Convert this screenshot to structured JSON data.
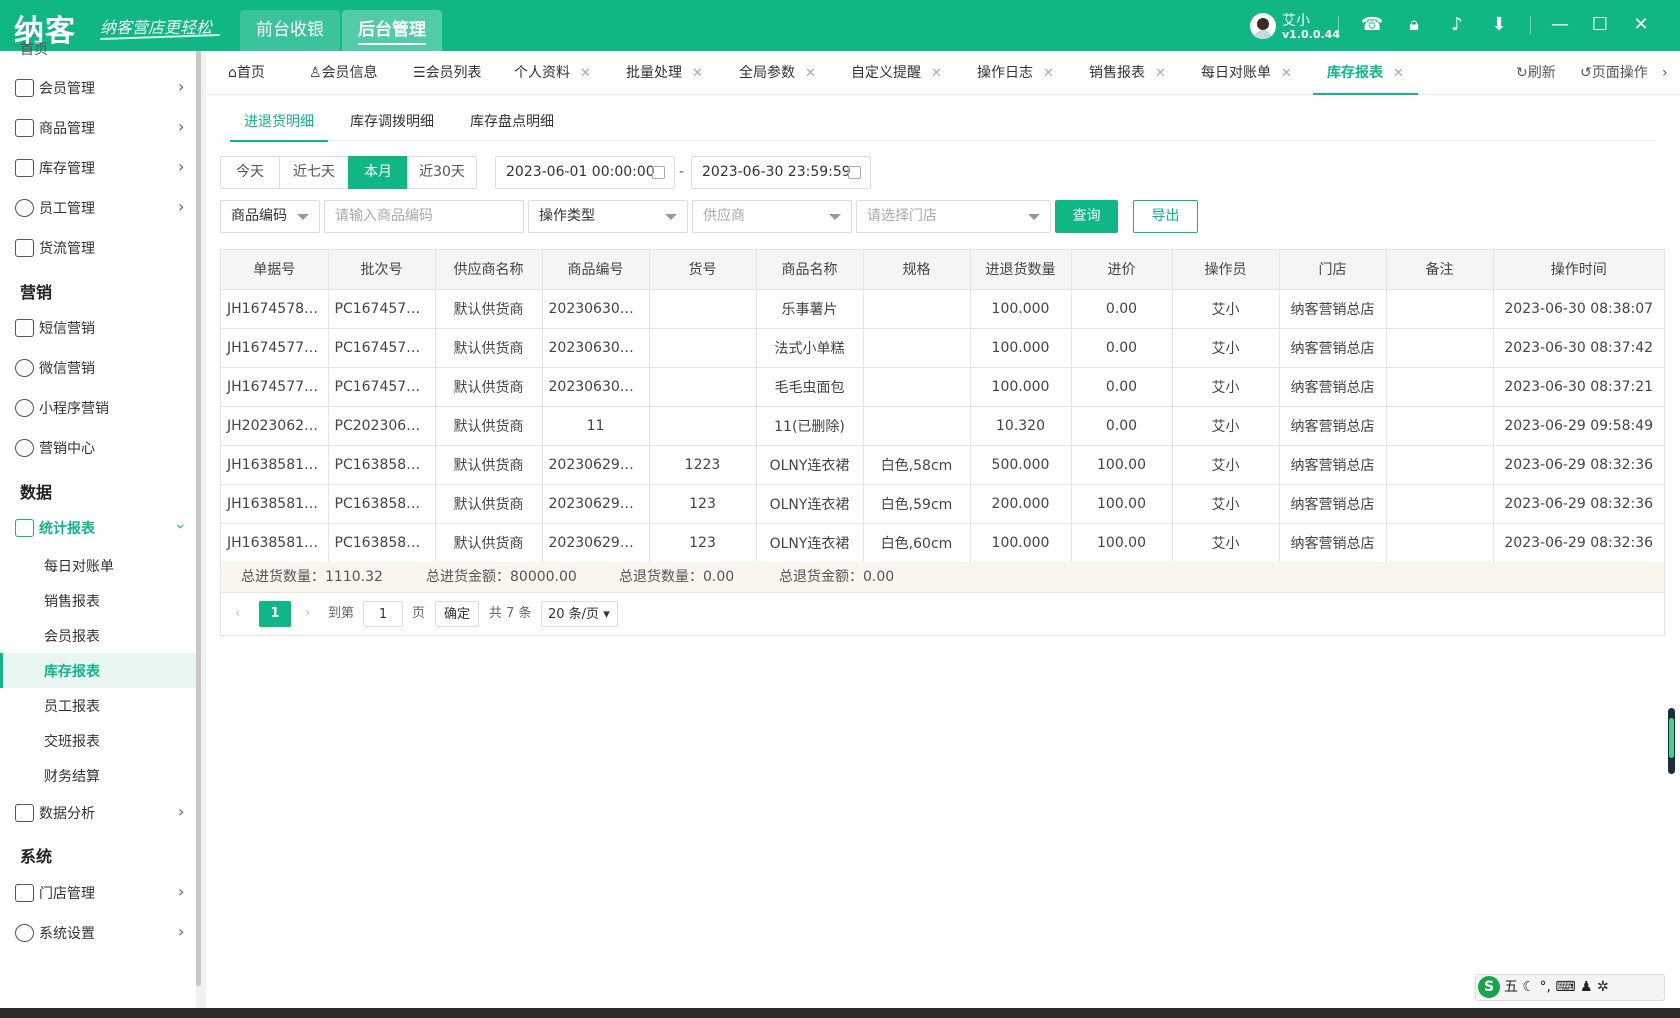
{
  "brand": {
    "logo": "纳客",
    "slogan": "纳客营店更轻松"
  },
  "topnav": [
    {
      "label": "前台收银"
    },
    {
      "label": "后台管理"
    }
  ],
  "user": {
    "name": "艾小",
    "version": "v1.0.0.44"
  },
  "toolbar_icons": [
    "headset-icon",
    "lock-icon",
    "bell-icon",
    "download-icon",
    "minimize-icon",
    "maximize-icon",
    "close-icon"
  ],
  "sidebar": {
    "top_partial": "首页",
    "items_a": [
      {
        "label": "会员管理",
        "icon": "crown-icon"
      },
      {
        "label": "商品管理",
        "icon": "goods-icon"
      },
      {
        "label": "库存管理",
        "icon": "inventory-icon"
      },
      {
        "label": "员工管理",
        "icon": "user-icon"
      },
      {
        "label": "货流管理",
        "icon": "truck-icon"
      }
    ],
    "group_marketing": "营销",
    "items_b": [
      {
        "label": "短信营销",
        "icon": "mail-icon"
      },
      {
        "label": "微信营销",
        "icon": "wechat-icon"
      },
      {
        "label": "小程序营销",
        "icon": "miniapp-icon"
      },
      {
        "label": "营销中心",
        "icon": "target-icon"
      }
    ],
    "group_data": "数据",
    "stats": {
      "label": "统计报表",
      "icon": "bar-chart-icon"
    },
    "stats_sub": [
      {
        "label": "每日对账单"
      },
      {
        "label": "销售报表"
      },
      {
        "label": "会员报表"
      },
      {
        "label": "库存报表"
      },
      {
        "label": "员工报表"
      },
      {
        "label": "交班报表"
      },
      {
        "label": "财务结算"
      }
    ],
    "analysis": {
      "label": "数据分析",
      "icon": "analysis-icon"
    },
    "group_system": "系统",
    "items_c": [
      {
        "label": "门店管理",
        "icon": "store-icon"
      },
      {
        "label": "系统设置",
        "icon": "gear-icon"
      }
    ]
  },
  "tabs": [
    {
      "label": "首页",
      "closable": false
    },
    {
      "label": "会员信息",
      "closable": false
    },
    {
      "label": "会员列表",
      "closable": false
    },
    {
      "label": "个人资料",
      "closable": true
    },
    {
      "label": "批量处理",
      "closable": true
    },
    {
      "label": "全局参数",
      "closable": true
    },
    {
      "label": "自定义提醒",
      "closable": true
    },
    {
      "label": "操作日志",
      "closable": true
    },
    {
      "label": "销售报表",
      "closable": true
    },
    {
      "label": "每日对账单",
      "closable": true
    },
    {
      "label": "库存报表",
      "closable": true
    }
  ],
  "tab_tools": {
    "refresh": "刷新",
    "page_ops": "页面操作"
  },
  "subtabs": [
    "进退货明细",
    "库存调拨明细",
    "库存盘点明细"
  ],
  "quick_range": [
    "今天",
    "近七天",
    "本月",
    "近30天"
  ],
  "date_start": "2023-06-01 00:00:00",
  "date_end": "2023-06-30 23:59:59",
  "date_sep": "-",
  "filters": {
    "code_type": "商品编码",
    "code_placeholder": "请输入商品编码",
    "op_type": "操作类型",
    "supplier": "供应商",
    "store": "请选择门店",
    "query": "查询",
    "export": "导出"
  },
  "table": {
    "columns": [
      "单据号",
      "批次号",
      "供应商名称",
      "商品编号",
      "货号",
      "商品名称",
      "规格",
      "进退货数量",
      "进价",
      "操作员",
      "门店",
      "备注",
      "操作时间"
    ],
    "rows": [
      [
        "JH16745780...",
        "PC16745780...",
        "默认供货商",
        "2023063008...",
        "",
        "乐事薯片",
        "",
        "100.000",
        "0.00",
        "艾小",
        "纳客营销总店",
        "",
        "2023-06-30 08:38:07"
      ],
      [
        "JH16745779...",
        "PC16745779...",
        "默认供货商",
        "2023063008...",
        "",
        "法式小单糕",
        "",
        "100.000",
        "0.00",
        "艾小",
        "纳客营销总店",
        "",
        "2023-06-30 08:37:42"
      ],
      [
        "JH16745778...",
        "PC16745778...",
        "默认供货商",
        "2023063008...",
        "",
        "毛毛虫面包",
        "",
        "100.000",
        "0.00",
        "艾小",
        "纳客营销总店",
        "",
        "2023-06-30 08:37:21"
      ],
      [
        "JH20230629...",
        "PC20230629...",
        "默认供货商",
        "11",
        "",
        "11(已删除)",
        "",
        "10.320",
        "0.00",
        "艾小",
        "纳客营销总店",
        "",
        "2023-06-29 09:58:49"
      ],
      [
        "JH16385814...",
        "PC16385814...",
        "默认供货商",
        "2023062908...",
        "1223",
        "OLNY连衣裙",
        "白色,58cm",
        "500.000",
        "100.00",
        "艾小",
        "纳客营销总店",
        "",
        "2023-06-29 08:32:36"
      ],
      [
        "JH16385814...",
        "PC16385814...",
        "默认供货商",
        "2023062908...",
        "123",
        "OLNY连衣裙",
        "白色,59cm",
        "200.000",
        "100.00",
        "艾小",
        "纳客营销总店",
        "",
        "2023-06-29 08:32:36"
      ],
      [
        "JH16385814...",
        "PC16385814...",
        "默认供货商",
        "2023062908...",
        "123",
        "OLNY连衣裙",
        "白色,60cm",
        "100.000",
        "100.00",
        "艾小",
        "纳客营销总店",
        "",
        "2023-06-29 08:32:36"
      ]
    ]
  },
  "summary": {
    "total_qty": "总进货数量：1110.32",
    "total_amount": "总进货金额：80000.00",
    "return_qty": "总退货数量：0.00",
    "return_amount": "总退货金额：0.00"
  },
  "pager": {
    "current": "1",
    "goto_label": "到第",
    "goto_value": "1",
    "page_unit": "页",
    "confirm": "确定",
    "total": "共 7 条",
    "page_size": "20 条/页"
  },
  "ime": {
    "label": "五",
    "extra": "☾ °, ⌨ ♟ ✲"
  }
}
